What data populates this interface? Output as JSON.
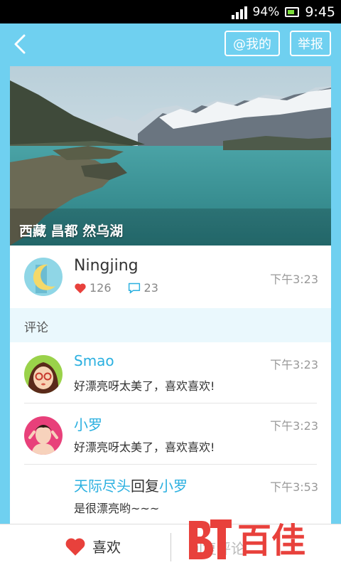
{
  "status": {
    "battery_pct": "94%",
    "time": "9:45"
  },
  "header": {
    "mine_button": "@我的",
    "report_button": "举报"
  },
  "post": {
    "location": "西藏 昌都 然乌湖",
    "author": "Ningjing",
    "likes": "126",
    "comments": "23",
    "time": "下午3:23"
  },
  "comments_section": {
    "title": "评论"
  },
  "comments": [
    {
      "name": "Smao",
      "text": "好漂亮呀太美了，喜欢喜欢!",
      "time": "下午3:23"
    },
    {
      "name": "小罗",
      "text": "好漂亮呀太美了，喜欢喜欢!",
      "time": "下午3:23"
    },
    {
      "from": "天际尽头",
      "reply_word": "回复",
      "to": "小罗",
      "text": "是很漂亮哟~~~",
      "time": "下午3:53"
    }
  ],
  "bottom": {
    "like_label": "喜欢",
    "reply_label": "回复评论"
  },
  "watermark": "百佳",
  "colors": {
    "accent": "#2bb0e0",
    "bar": "#6fd0f0",
    "heart": "#e8413c"
  }
}
